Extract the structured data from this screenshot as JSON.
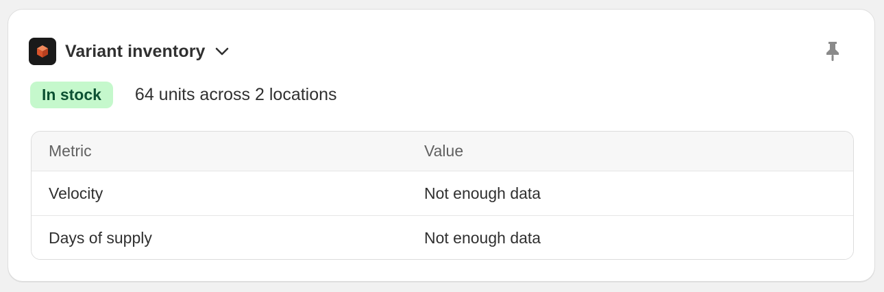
{
  "widget": {
    "title": "Variant inventory",
    "app_icon": "cube-icon",
    "pin_icon": "pin-icon",
    "chevron_icon": "chevron-down-icon"
  },
  "status": {
    "badge": "In stock",
    "summary": "64 units across 2 locations"
  },
  "table": {
    "headers": [
      "Metric",
      "Value"
    ],
    "rows": [
      [
        "Velocity",
        "Not enough data"
      ],
      [
        "Days of supply",
        "Not enough data"
      ]
    ]
  },
  "colors": {
    "badge_bg": "#c5f8cc",
    "badge_text": "#0c5132",
    "icon_bg": "#1a1a1a",
    "cube": "#e8643c"
  }
}
